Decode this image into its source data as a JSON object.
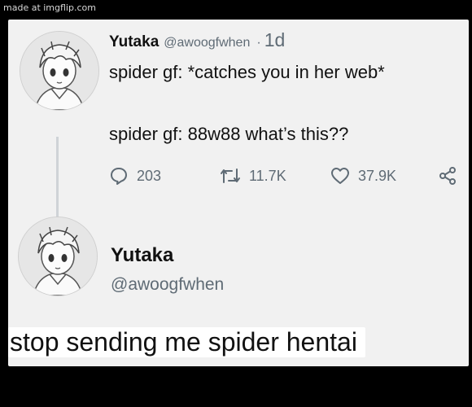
{
  "watermark": "made at imgflip.com",
  "tweet": {
    "author_name": "Yutaka",
    "author_handle": "@awoogfwhen",
    "separator": "·",
    "time": "1d",
    "line1": "spider gf: *catches you in her web*",
    "line2": "spider gf: 88w88 what’s this??",
    "stats": {
      "replies": "203",
      "retweets": "11.7K",
      "likes": "37.9K"
    }
  },
  "reply": {
    "author_name": "Yutaka",
    "author_handle": "@awoogfwhen",
    "text": "stop sending me spider hentai"
  },
  "colors": {
    "background": "#000000",
    "card": "#f1f1f1",
    "muted_text": "#5f6b75",
    "text": "#111111"
  },
  "icons": [
    "avatar-anime-boy",
    "reply-icon",
    "retweet-icon",
    "like-icon",
    "share-icon"
  ]
}
